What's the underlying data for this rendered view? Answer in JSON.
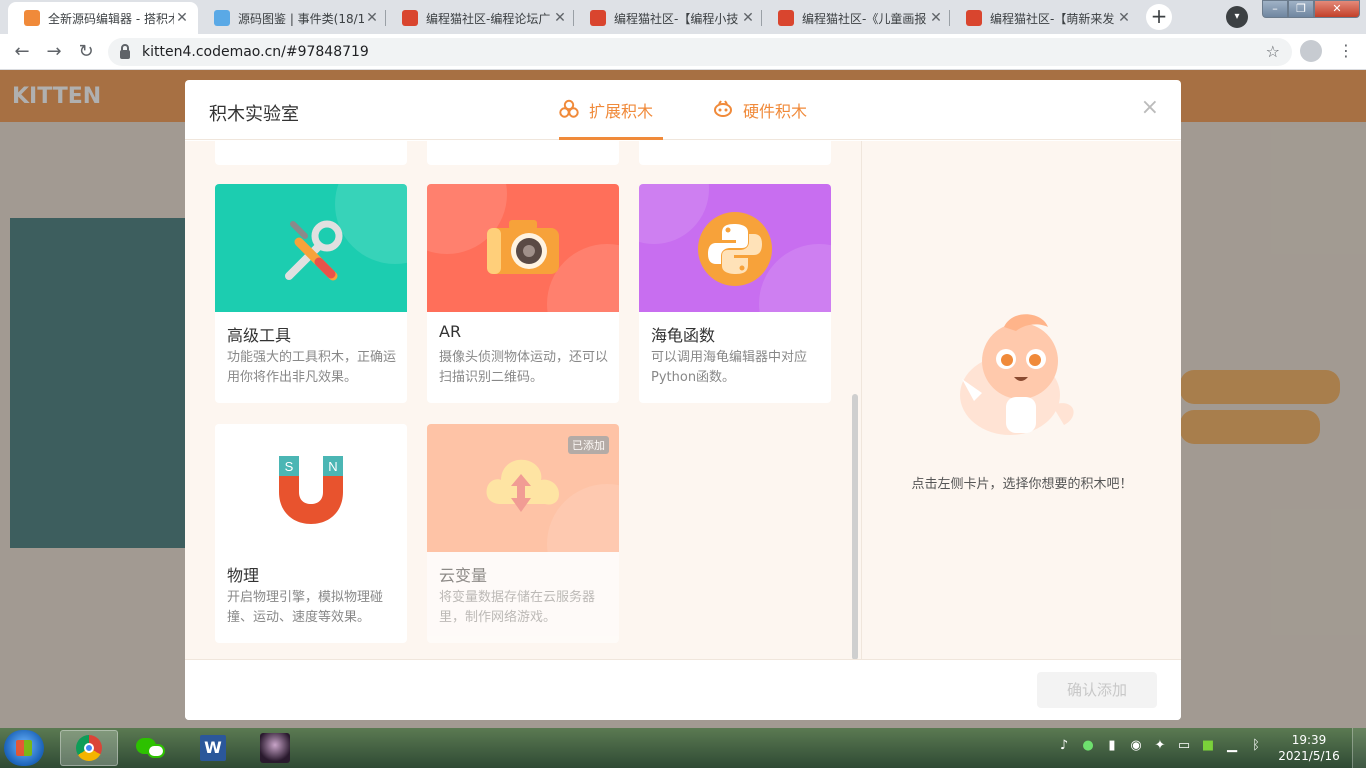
{
  "browser": {
    "tabs": [
      {
        "title": "全新源码编辑器 - 搭积木",
        "favicon_color": "#f08a3a",
        "active": true
      },
      {
        "title": "源码图鉴 | 事件类(18/1",
        "favicon_color": "#5aa9e6",
        "active": false
      },
      {
        "title": "编程猫社区-编程论坛广",
        "favicon_color": "#d9452e",
        "active": false
      },
      {
        "title": "编程猫社区-【编程小技",
        "favicon_color": "#d9452e",
        "active": false
      },
      {
        "title": "编程猫社区-《儿童画报",
        "favicon_color": "#d9452e",
        "active": false
      },
      {
        "title": "编程猫社区-【萌新来发",
        "favicon_color": "#d9452e",
        "active": false
      }
    ],
    "tab_close_glyph": "✕",
    "new_tab_glyph": "+",
    "url": "kitten4.codemao.cn/#97848719",
    "icons": [
      "back-icon",
      "forward-icon",
      "reload-icon",
      "lock-icon",
      "star-icon",
      "profile-icon",
      "menu-icon"
    ]
  },
  "background_app": {
    "logo": "KITTEN"
  },
  "modal": {
    "title": "积木实验室",
    "tabs": [
      {
        "label": "扩展积木",
        "icon": "extension-blocks-icon",
        "active": true
      },
      {
        "label": "硬件积木",
        "icon": "hardware-blocks-icon",
        "active": false
      }
    ],
    "close_glyph": "×",
    "cards": [
      {
        "title": "高级工具",
        "desc": "功能强大的工具积木，正确运用你将作出非凡效果。",
        "color": "#1ccdb0",
        "icon": "tools-icon",
        "added": false
      },
      {
        "title": "AR",
        "desc": "摄像头侦测物体运动，还可以扫描识别二维码。",
        "color": "#ff6f5a",
        "icon": "camera-icon",
        "added": false
      },
      {
        "title": "海龟函数",
        "desc": "可以调用海龟编辑器中对应Python函数。",
        "color": "#c86ef0",
        "icon": "python-icon",
        "added": false
      },
      {
        "title": "物理",
        "desc": "开启物理引擎，模拟物理碰撞、运动、速度等效果。",
        "color": "#ffffff",
        "icon": "magnet-icon",
        "added": false
      },
      {
        "title": "云变量",
        "desc": "将变量数据存储在云服务器里，制作网络游戏。",
        "color": "#ff9a6a",
        "icon": "cloud-upload-icon",
        "added": true,
        "badge": "已添加"
      }
    ],
    "side_hint": "点击左侧卡片，选择你想要的积木吧！",
    "mascot_icon": "kitten-mascot-icon",
    "confirm_label": "确认添加"
  },
  "taskbar": {
    "apps": [
      "chrome-icon",
      "wechat-icon",
      "word-icon",
      "avatar-app-icon"
    ],
    "word_letter": "W",
    "tray_icons": [
      "volume-icon",
      "wechat-tray-icon",
      "battery-icon",
      "qq-icon",
      "network-tool-icon",
      "monitor-icon",
      "nvidia-icon",
      "signal-icon",
      "bluetooth-icon"
    ],
    "time": "19:39",
    "date": "2021/5/16"
  }
}
